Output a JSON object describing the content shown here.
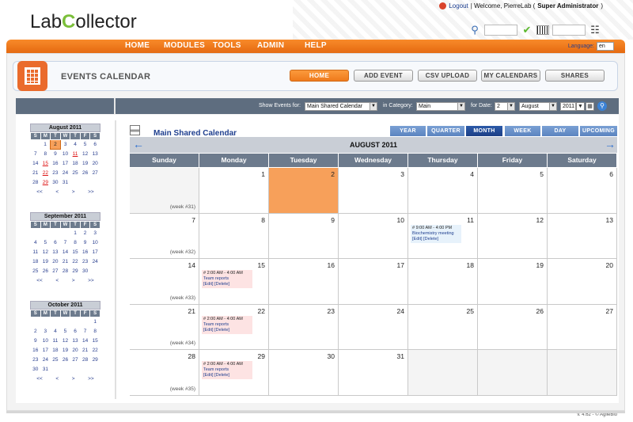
{
  "header": {
    "logo_a": "Lab",
    "logo_c": "C",
    "logo_b": "ollector",
    "logout": "Logout",
    "welcome": "| Welcome, PierreLab (",
    "role": "Super Administrator",
    "role_close": ")"
  },
  "menu": [
    "HOME",
    "MODULES",
    "TOOLS",
    "ADMIN",
    "HELP"
  ],
  "language": {
    "label": "Language:",
    "value": "en"
  },
  "page": {
    "title": "EVENTS CALENDAR"
  },
  "top_buttons": [
    "HOME",
    "ADD EVENT",
    "CSV UPLOAD",
    "MY CALENDARS",
    "SHARES"
  ],
  "filter": {
    "show_label": "Show Events for:",
    "calendar": "Main Shared Calendar",
    "category_label": "in Category:",
    "category": "Main",
    "date_label": "for Date:",
    "day": "2",
    "month": "August",
    "year": "2011"
  },
  "mini_calendars": [
    {
      "title": "August 2011",
      "weeks": [
        [
          "",
          "1",
          "2",
          "3",
          "4",
          "5",
          "6"
        ],
        [
          "7",
          "8",
          "9",
          "10",
          "11",
          "12",
          "13"
        ],
        [
          "14",
          "15",
          "16",
          "17",
          "18",
          "19",
          "20"
        ],
        [
          "21",
          "22",
          "23",
          "24",
          "25",
          "26",
          "27"
        ],
        [
          "28",
          "29",
          "30",
          "31",
          "",
          "",
          ""
        ]
      ]
    },
    {
      "title": "September 2011",
      "weeks": [
        [
          "",
          "",
          "",
          "",
          "1",
          "2",
          "3"
        ],
        [
          "4",
          "5",
          "6",
          "7",
          "8",
          "9",
          "10"
        ],
        [
          "11",
          "12",
          "13",
          "14",
          "15",
          "16",
          "17"
        ],
        [
          "18",
          "19",
          "20",
          "21",
          "22",
          "23",
          "24"
        ],
        [
          "25",
          "26",
          "27",
          "28",
          "29",
          "30",
          ""
        ]
      ]
    },
    {
      "title": "October 2011",
      "weeks": [
        [
          "",
          "",
          "",
          "",
          "",
          "",
          "1"
        ],
        [
          "2",
          "3",
          "4",
          "5",
          "6",
          "7",
          "8"
        ],
        [
          "9",
          "10",
          "11",
          "12",
          "13",
          "14",
          "15"
        ],
        [
          "16",
          "17",
          "18",
          "19",
          "20",
          "21",
          "22"
        ],
        [
          "23",
          "24",
          "25",
          "26",
          "27",
          "28",
          "29"
        ],
        [
          "30",
          "31",
          "",
          "",
          "",
          "",
          ""
        ]
      ]
    }
  ],
  "mini_dow": [
    "S",
    "M",
    "T",
    "W",
    "T",
    "F",
    "S"
  ],
  "mini_nav": [
    "<<",
    "<",
    ">",
    ">>"
  ],
  "calendar": {
    "name": "Main Shared Calendar",
    "views": [
      "YEAR",
      "QUARTER",
      "MONTH",
      "WEEK",
      "DAY",
      "UPCOMING"
    ],
    "active_view": "MONTH",
    "month_label": "AUGUST 2011",
    "prev_icon": "←",
    "next_icon": "→",
    "days": [
      "Sunday",
      "Monday",
      "Tuesday",
      "Wednesday",
      "Thursday",
      "Friday",
      "Saturday"
    ],
    "weeks": [
      {
        "label": "(week #31)",
        "days": [
          "",
          "1",
          "2",
          "3",
          "4",
          "5",
          "6"
        ]
      },
      {
        "label": "(week #32)",
        "days": [
          "7",
          "8",
          "9",
          "10",
          "11",
          "12",
          "13"
        ]
      },
      {
        "label": "(week #33)",
        "days": [
          "14",
          "15",
          "16",
          "17",
          "18",
          "19",
          "20"
        ]
      },
      {
        "label": "(week #34)",
        "days": [
          "21",
          "22",
          "23",
          "24",
          "25",
          "26",
          "27"
        ]
      },
      {
        "label": "(week #35)",
        "days": [
          "28",
          "29",
          "30",
          "31",
          "",
          "",
          ""
        ]
      }
    ],
    "today": "2",
    "events": [
      {
        "week": 1,
        "day": 4,
        "time": "# 9:00 AM - 4:00 PM",
        "name": "Biochemistry meeting",
        "edit": "[Edit]",
        "delete": "[Delete]",
        "style": "blue"
      },
      {
        "week": 2,
        "day": 1,
        "time": "# 2:00 AM - 4:00 AM",
        "name": "Team reports",
        "edit": "[Edit]",
        "delete": "[Delete]",
        "style": "pink"
      },
      {
        "week": 3,
        "day": 1,
        "time": "# 2:00 AM - 4:00 AM",
        "name": "Team reports",
        "edit": "[Edit]",
        "delete": "[Delete]",
        "style": "pink"
      },
      {
        "week": 4,
        "day": 1,
        "time": "# 2:00 AM - 4:00 AM",
        "name": "Team reports",
        "edit": "[Edit]",
        "delete": "[Delete]",
        "style": "pink"
      }
    ]
  },
  "footer": "v. 4.62 - © AgileBio"
}
